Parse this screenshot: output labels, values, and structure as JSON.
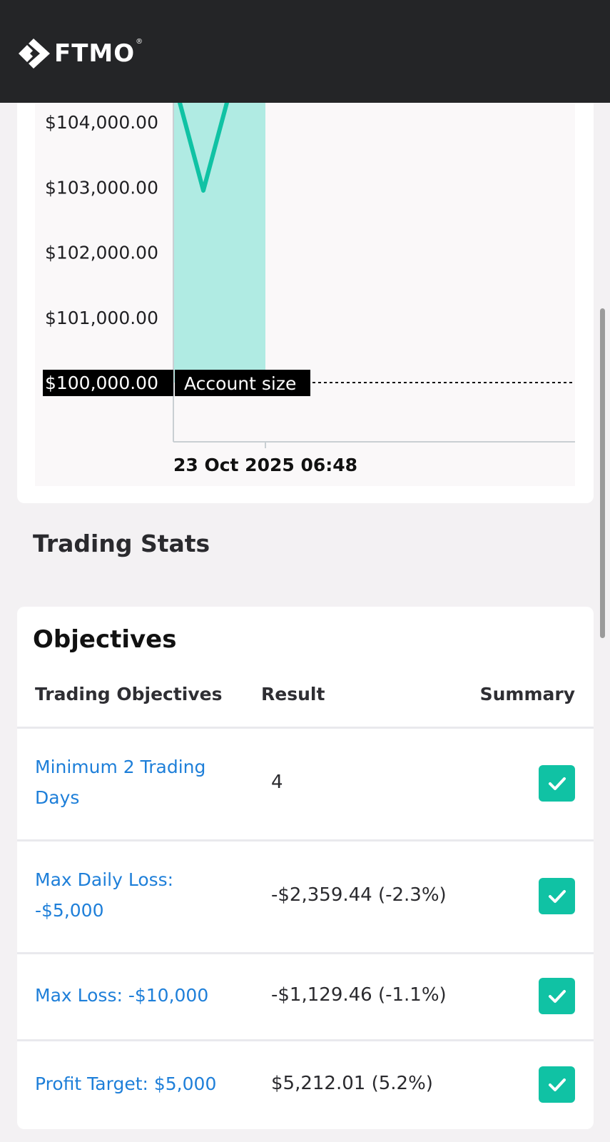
{
  "header": {
    "logo_text": "FTMO",
    "logo_mark": "®"
  },
  "chart_data": {
    "type": "line",
    "y_ticks": [
      "$104,000.00",
      "$103,000.00",
      "$102,000.00",
      "$101,000.00",
      "$100,000.00"
    ],
    "y_tick_values": [
      104000,
      103000,
      102000,
      101000,
      100000
    ],
    "x_ticks": [
      "23 Oct 2025 06:48"
    ],
    "series": [
      {
        "values": [
          {
            "x": "23 Oct 2025 06:48",
            "y": 104300
          },
          {
            "x": "23 Oct 2025 06:48",
            "y": 102950
          },
          {
            "x": "23 Oct 2025 06:48",
            "y": 104300
          }
        ]
      }
    ],
    "reference_line": {
      "value": 100000,
      "label": "Account size"
    },
    "colors": {
      "line": "#10c2a4",
      "band": "#b0ebe3"
    }
  },
  "stats": {
    "title": "Trading Stats"
  },
  "objectives": {
    "title": "Objectives",
    "columns": [
      "Trading Objectives",
      "Result",
      "Summary"
    ],
    "rows": [
      {
        "label": "Minimum 2 Trading Days",
        "result": "4",
        "passed": true
      },
      {
        "label": "Max Daily Loss: -$5,000",
        "result": "-$2,359.44 (-2.3%)",
        "passed": true
      },
      {
        "label": "Max Loss: -$10,000",
        "result": "-$1,129.46 (-1.1%)",
        "passed": true
      },
      {
        "label": "Profit Target: $5,000",
        "result": "$5,212.01 (5.2%)",
        "passed": true
      }
    ]
  }
}
